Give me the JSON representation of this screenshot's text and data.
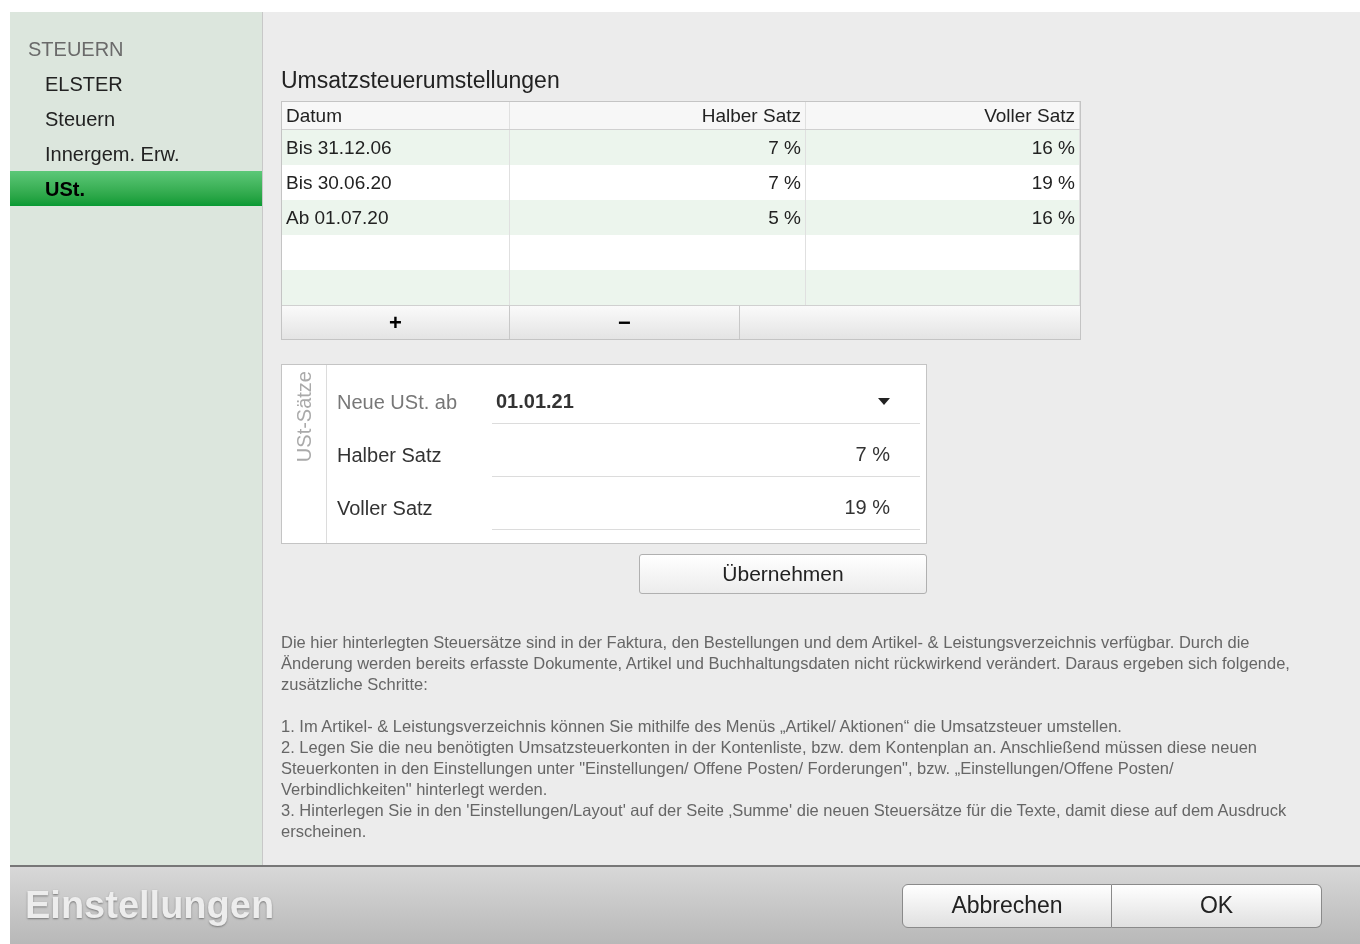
{
  "sidebar": {
    "section": "STEUERN",
    "items": [
      {
        "label": "ELSTER",
        "selected": false
      },
      {
        "label": "Steuern",
        "selected": false
      },
      {
        "label": "Innergem. Erw.",
        "selected": false
      },
      {
        "label": "USt.",
        "selected": true
      }
    ]
  },
  "title": "Umsatzsteuerumstellungen",
  "table": {
    "columns": [
      "Datum",
      "Halber Satz",
      "Voller Satz"
    ],
    "rows": [
      [
        "Bis 31.12.06",
        "7 %",
        "16 %"
      ],
      [
        "Bis 30.06.20",
        "7 %",
        "19 %"
      ],
      [
        "Ab 01.07.20",
        "5 %",
        "16 %"
      ]
    ],
    "add_button": "+",
    "remove_button": "−"
  },
  "rates_box": {
    "legend": "USt-Sätze",
    "fields": [
      {
        "kind": "dropdown",
        "label": "Neue USt. ab",
        "value": "01.01.21"
      },
      {
        "kind": "text",
        "label": "Halber Satz",
        "value": "7 %"
      },
      {
        "kind": "text",
        "label": "Voller Satz",
        "value": "19 %"
      }
    ]
  },
  "apply_button": "Übernehmen",
  "description": "Die hier hinterlegten Steuersätze sind in der Faktura, den Bestellungen und dem Artikel- & Leistungsverzeichnis verfügbar. Durch die Änderung werden bereits erfasste Dokumente, Artikel und Buchhaltungsdaten nicht rückwirkend verändert. Daraus ergeben sich folgende, zusätzliche Schritte:",
  "steps": [
    "1. Im Artikel- & Leistungsverzeichnis können Sie mithilfe des Menüs „Artikel/ Aktionen“ die Umsatzsteuer umstellen.",
    "2. Legen Sie die neu benötigten Umsatzsteuerkonten in der Kontenliste, bzw. dem Kontenplan an. Anschließend müssen diese neuen Steuerkonten in den Einstellungen unter \"Einstellungen/ Offene Posten/ Forderungen\", bzw. „Einstellungen/Offene Posten/ Verbindlichkeiten\" hinterlegt werden.",
    "3. Hinterlegen Sie in den 'Einstellungen/Layout' auf der Seite ‚Summe' die neuen Steuersätze für die Texte, damit diese auf dem Ausdruck erscheinen."
  ],
  "footer": {
    "title": "Einstellungen",
    "buttons": [
      "Abbrechen",
      "OK"
    ]
  }
}
